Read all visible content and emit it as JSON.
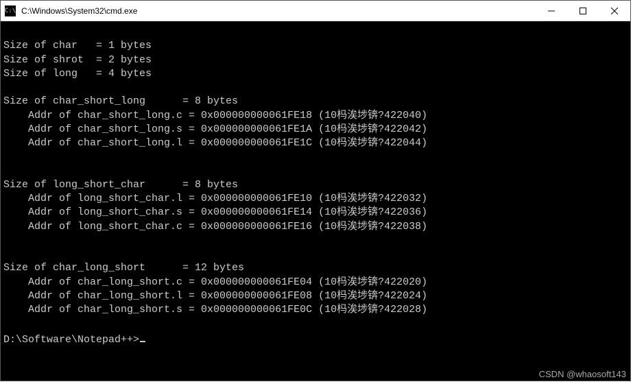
{
  "window": {
    "title": "C:\\Windows\\System32\\cmd.exe",
    "icon_glyph": "C:\\"
  },
  "output": {
    "sizes": {
      "char": {
        "label": "Size of char   = 1 bytes",
        "bytes": 1
      },
      "short": {
        "label": "Size of shrot  = 2 bytes",
        "bytes": 2
      },
      "long": {
        "label": "Size of long   = 4 bytes",
        "bytes": 4
      }
    },
    "blocks": [
      {
        "name": "char_short_long",
        "size_line": "Size of char_short_long      = 8 bytes",
        "size_bytes": 8,
        "members": [
          {
            "field": "c",
            "addr": "0x000000000061FE18",
            "dec_note": "10杩涘埗锛?422040",
            "line": "    Addr of char_short_long.c = 0x000000000061FE18 (10杩涘埗锛?422040)"
          },
          {
            "field": "s",
            "addr": "0x000000000061FE1A",
            "dec_note": "10杩涘埗锛?422042",
            "line": "    Addr of char_short_long.s = 0x000000000061FE1A (10杩涘埗锛?422042)"
          },
          {
            "field": "l",
            "addr": "0x000000000061FE1C",
            "dec_note": "10杩涘埗锛?422044",
            "line": "    Addr of char_short_long.l = 0x000000000061FE1C (10杩涘埗锛?422044)"
          }
        ]
      },
      {
        "name": "long_short_char",
        "size_line": "Size of long_short_char      = 8 bytes",
        "size_bytes": 8,
        "members": [
          {
            "field": "l",
            "addr": "0x000000000061FE10",
            "dec_note": "10杩涘埗锛?422032",
            "line": "    Addr of long_short_char.l = 0x000000000061FE10 (10杩涘埗锛?422032)"
          },
          {
            "field": "s",
            "addr": "0x000000000061FE14",
            "dec_note": "10杩涘埗锛?422036",
            "line": "    Addr of long_short_char.s = 0x000000000061FE14 (10杩涘埗锛?422036)"
          },
          {
            "field": "c",
            "addr": "0x000000000061FE16",
            "dec_note": "10杩涘埗锛?422038",
            "line": "    Addr of long_short_char.c = 0x000000000061FE16 (10杩涘埗锛?422038)"
          }
        ]
      },
      {
        "name": "char_long_short",
        "size_line": "Size of char_long_short      = 12 bytes",
        "size_bytes": 12,
        "members": [
          {
            "field": "c",
            "addr": "0x000000000061FE04",
            "dec_note": "10杩涘埗锛?422020",
            "line": "    Addr of char_long_short.c = 0x000000000061FE04 (10杩涘埗锛?422020)"
          },
          {
            "field": "l",
            "addr": "0x000000000061FE08",
            "dec_note": "10杩涘埗锛?422024",
            "line": "    Addr of char_long_short.l = 0x000000000061FE08 (10杩涘埗锛?422024)"
          },
          {
            "field": "s",
            "addr": "0x000000000061FE0C",
            "dec_note": "10杩涘埗锛?422028",
            "line": "    Addr of char_long_short.s = 0x000000000061FE0C (10杩涘埗锛?422028)"
          }
        ]
      }
    ],
    "prompt": "D:\\Software\\Notepad++>"
  },
  "watermark": "CSDN @whaosoft143"
}
